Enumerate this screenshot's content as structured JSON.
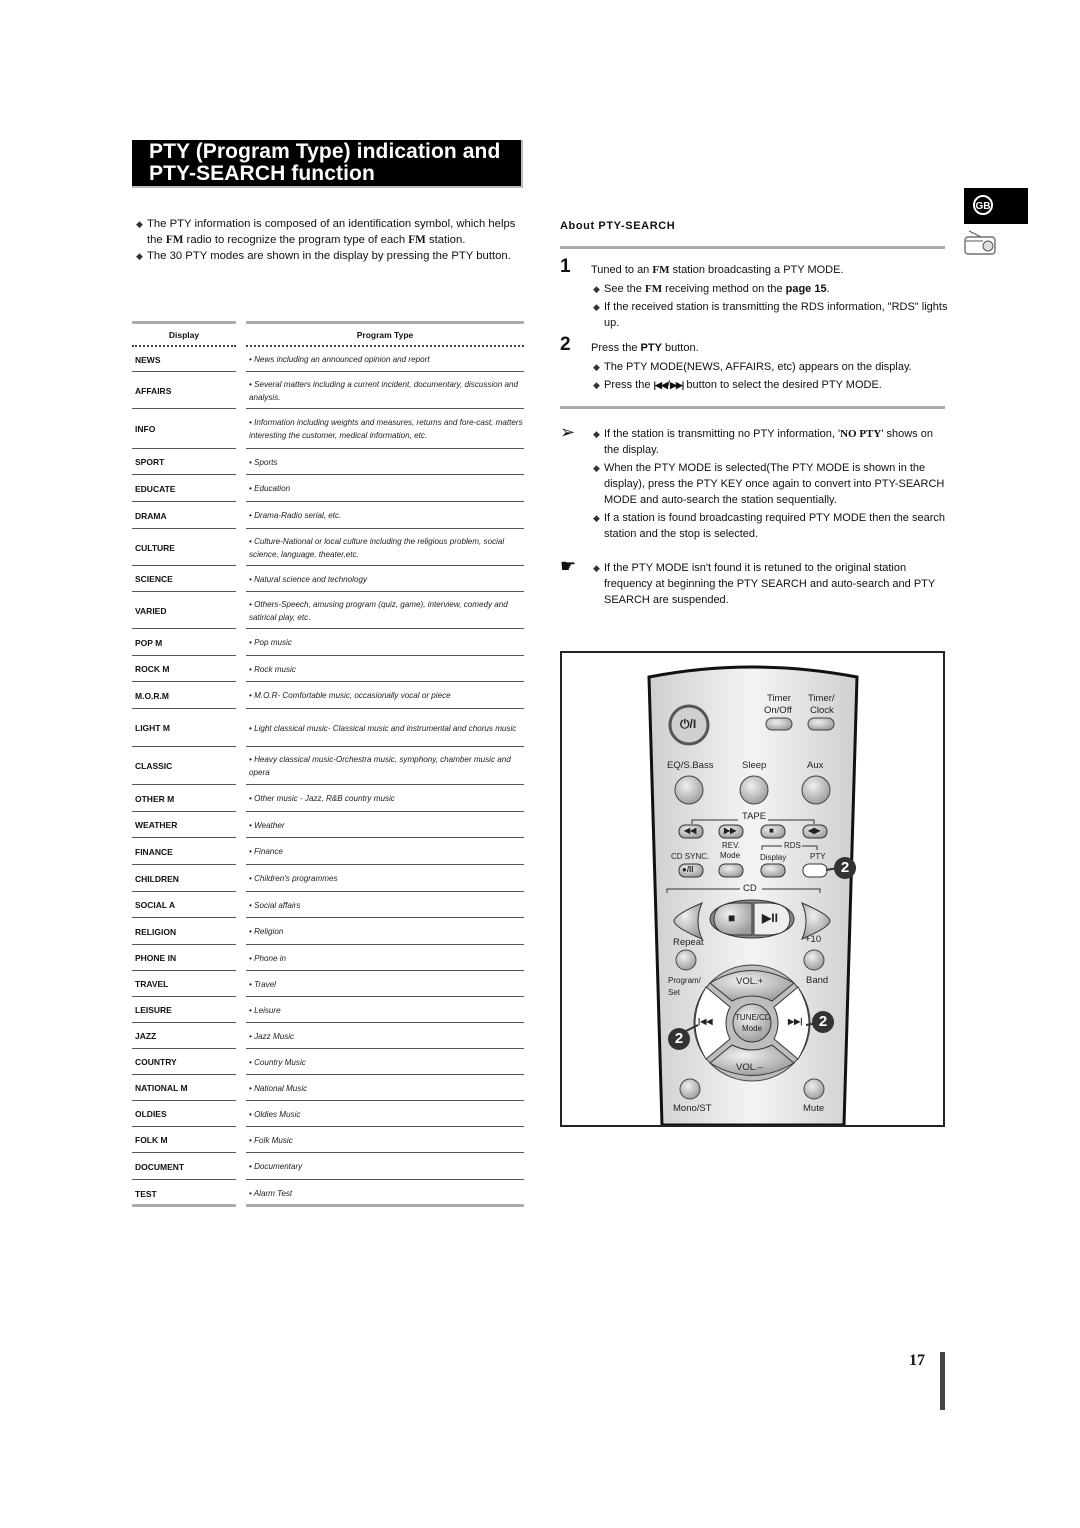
{
  "title": {
    "line1": "PTY (Program Type) indication and",
    "line2": "PTY-SEARCH function"
  },
  "intro": [
    {
      "pre": "The PTY information is composed of an identification symbol, which helps the ",
      "fm1": "FM",
      "mid": " radio to recognize the program type of each ",
      "fm2": "FM",
      "post": " station."
    },
    {
      "text": "The 30 PTY modes are shown in the display by pressing the PTY button."
    }
  ],
  "table": {
    "header_display": "Display",
    "header_type": "Program Type",
    "rows": [
      {
        "display": "NEWS",
        "type": "• News including an announced opinion and report"
      },
      {
        "display": "AFFAIRS",
        "type": "• Several matters including a current incident, documentary, discussion and analysis."
      },
      {
        "display": "INFO",
        "type": "•  Information including weights and measures, returns and fore-cast, matters interesting the customer, medical information, etc."
      },
      {
        "display": "SPORT",
        "type": "• Sports"
      },
      {
        "display": "EDUCATE",
        "type": "• Education"
      },
      {
        "display": "DRAMA",
        "type": "• Drama-Radio serial, etc."
      },
      {
        "display": "CULTURE",
        "type": "• Culture-National or local culture including the religious problem, social science, language, theater,etc."
      },
      {
        "display": "SCIENCE",
        "type": "• Natural science and technology"
      },
      {
        "display": "VARIED",
        "type": "• Others-Speech, amusing program (quiz, game), interview, comedy and satirical play, etc."
      },
      {
        "display": "POP M",
        "type": "• Pop music"
      },
      {
        "display": "ROCK M",
        "type": "• Rock music"
      },
      {
        "display": "M.O.R.M",
        "type": "• M.O.R- Comfortable music, occasionally vocal or piece"
      },
      {
        "display": "LIGHT M",
        "type": "• Light classical music- Classical music and instrumental and chorus music"
      },
      {
        "display": "CLASSIC",
        "type": "• Heavy classical  music-Orchestra music, symphony, chamber music and opera"
      },
      {
        "display": "OTHER M",
        "type": "• Other music - Jazz, R&B country music"
      },
      {
        "display": "WEATHER",
        "type": "• Weather"
      },
      {
        "display": "FINANCE",
        "type": "• Finance"
      },
      {
        "display": "CHILDREN",
        "type": "• Children's programmes"
      },
      {
        "display": "SOCIAL  A",
        "type": "• Social affairs"
      },
      {
        "display": "RELIGION",
        "type": "• Religion"
      },
      {
        "display": "PHONE IN",
        "type": "• Phone in"
      },
      {
        "display": "TRAVEL",
        "type": "• Travel"
      },
      {
        "display": "LEISURE",
        "type": "• Leisure"
      },
      {
        "display": "JAZZ",
        "type": "• Jazz Music"
      },
      {
        "display": "COUNTRY",
        "type": "• Country Music"
      },
      {
        "display": "NATIONAL M",
        "type": "• National Music"
      },
      {
        "display": "OLDIES",
        "type": "• Oldies Music"
      },
      {
        "display": "FOLK M",
        "type": "• Folk Music"
      },
      {
        "display": "DOCUMENT",
        "type": "• Documentary"
      },
      {
        "display": "TEST",
        "type": "• Alarm Test"
      }
    ]
  },
  "side_tab": {
    "label": "GB",
    "icon": "radio-icon"
  },
  "about": {
    "heading": "About PTY-SEARCH",
    "step1": {
      "num": "1",
      "main_pre": "Tuned to an ",
      "main_fm": "FM",
      "main_post": " station broadcasting a PTY MODE.",
      "sub1_pre": "See the ",
      "sub1_fm": "FM",
      "sub1_mid": " receiving method on the ",
      "sub1_bold": "page 15",
      "sub1_post": ".",
      "sub2": "If the received station is transmitting the RDS information, \"RDS\" lights up."
    },
    "step2": {
      "num": "2",
      "main_pre": "Press the ",
      "main_bold": "PTY",
      "main_post": " button.",
      "sub1": "The PTY MODE(NEWS, AFFAIRS, etc) appears on the display.",
      "sub2_pre": "Press the ",
      "sub2_prev": "|◀◀",
      "sub2_slash": "/",
      "sub2_next": "▶▶|",
      "sub2_post": " button to select the desired PTY MODE."
    },
    "notes": {
      "note1_pre": "If the station is transmitting no PTY information, '",
      "note1_bold": "NO PTY",
      "note1_post": "' shows on the display.",
      "note2": "When the PTY MODE is selected(The PTY MODE is shown in  the display), press the PTY KEY once again to convert into PTY-SEARCH MODE and auto-search the station sequentially.",
      "note3": "If a station is found broadcasting required PTY MODE then the search station and the stop is selected."
    },
    "tip": "If the PTY MODE isn't found it is retuned to the original station frequency at beginning the PTY SEARCH and auto-search and PTY SEARCH are suspended."
  },
  "remote": {
    "power": "⏻/I",
    "timer_onoff": "Timer\nOn/Off",
    "timer_onoff_1": "Timer",
    "timer_onoff_2": "On/Off",
    "timer_clock_1": "Timer/",
    "timer_clock_2": "Clock",
    "eq": "EQ/S.Bass",
    "sleep": "Sleep",
    "aux": "Aux",
    "tape": "TAPE",
    "tape_rew": "◀◀",
    "tape_ff": "▶▶",
    "tape_stop": "■",
    "tape_dir": "◀▶",
    "cd_sync": "CD SYNC.",
    "rev1": "REV.",
    "rev2": "Mode",
    "rds": "RDS",
    "display": "Display",
    "pty": "PTY",
    "rec": "●/II",
    "cd": "CD",
    "cd_stop": "■",
    "cd_play": "▶II",
    "repeat": "Repeat",
    "plus10": "+10",
    "program1": "Program/",
    "program2": "Set",
    "band": "Band",
    "vol_up": "VOL.+",
    "vol_down": "VOL.–",
    "tune1": "TUNE/CD",
    "tune2": "Mode",
    "skip_prev": "|◀◀",
    "skip_next": "▶▶|",
    "mono": "Mono/ST",
    "mute": "Mute",
    "callout": "2"
  },
  "page_number": "17"
}
